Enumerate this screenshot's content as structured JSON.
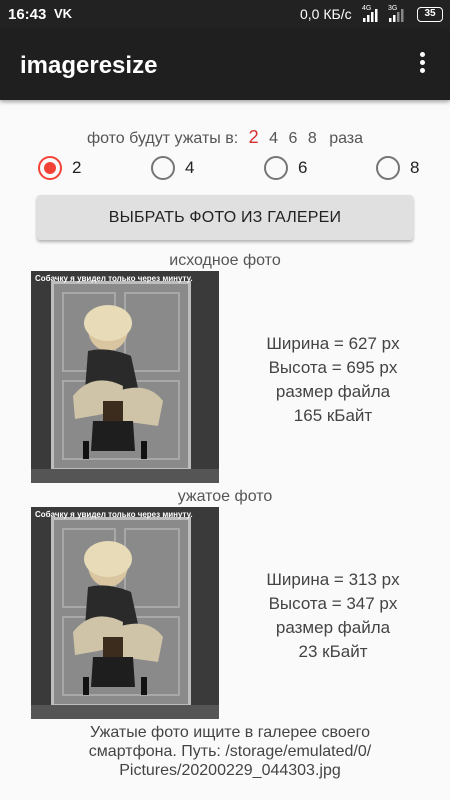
{
  "status_bar": {
    "time": "16:43",
    "vk_label": "VK",
    "speed": "0,0 КБ/с",
    "network_1": "4G",
    "network_2": "3G",
    "battery": "35"
  },
  "app_bar": {
    "title": "imageresize",
    "menu_icon": "more-vert-icon"
  },
  "compression": {
    "prefix": "фото будут ужаты в:",
    "options": [
      "2",
      "4",
      "6",
      "8"
    ],
    "selected": "2",
    "suffix": "раза",
    "radios": [
      {
        "label": "2",
        "checked": true
      },
      {
        "label": "4",
        "checked": false
      },
      {
        "label": "6",
        "checked": false
      },
      {
        "label": "8",
        "checked": false
      }
    ]
  },
  "select_button": "ВЫБРАТЬ ФОТО ИЗ ГАЛЕРЕИ",
  "original": {
    "caption": "исходное фото",
    "photo_overlay": "Собачку я увидел только через минуту.",
    "width": "Ширина = 627 px",
    "height": "Высота = 695 px",
    "size_label": "размер файла",
    "size": "165 кБайт"
  },
  "compressed": {
    "caption": "ужатое фото",
    "photo_overlay": "Собачку я увидел только через минуту.",
    "width": "Ширина = 313 px",
    "height": "Высота = 347 px",
    "size_label": "размер файла",
    "size": "23 кБайт"
  },
  "footer": {
    "line1": "Ужатые фото ищите в галерее своего",
    "line2": "смартфона.  Путь: /storage/emulated/0/",
    "line3": "Pictures/20200229_044303.jpg"
  },
  "colors": {
    "accent": "#f44336",
    "selected_ratio": "#d32f2f",
    "app_bar": "#1f1f1f"
  }
}
